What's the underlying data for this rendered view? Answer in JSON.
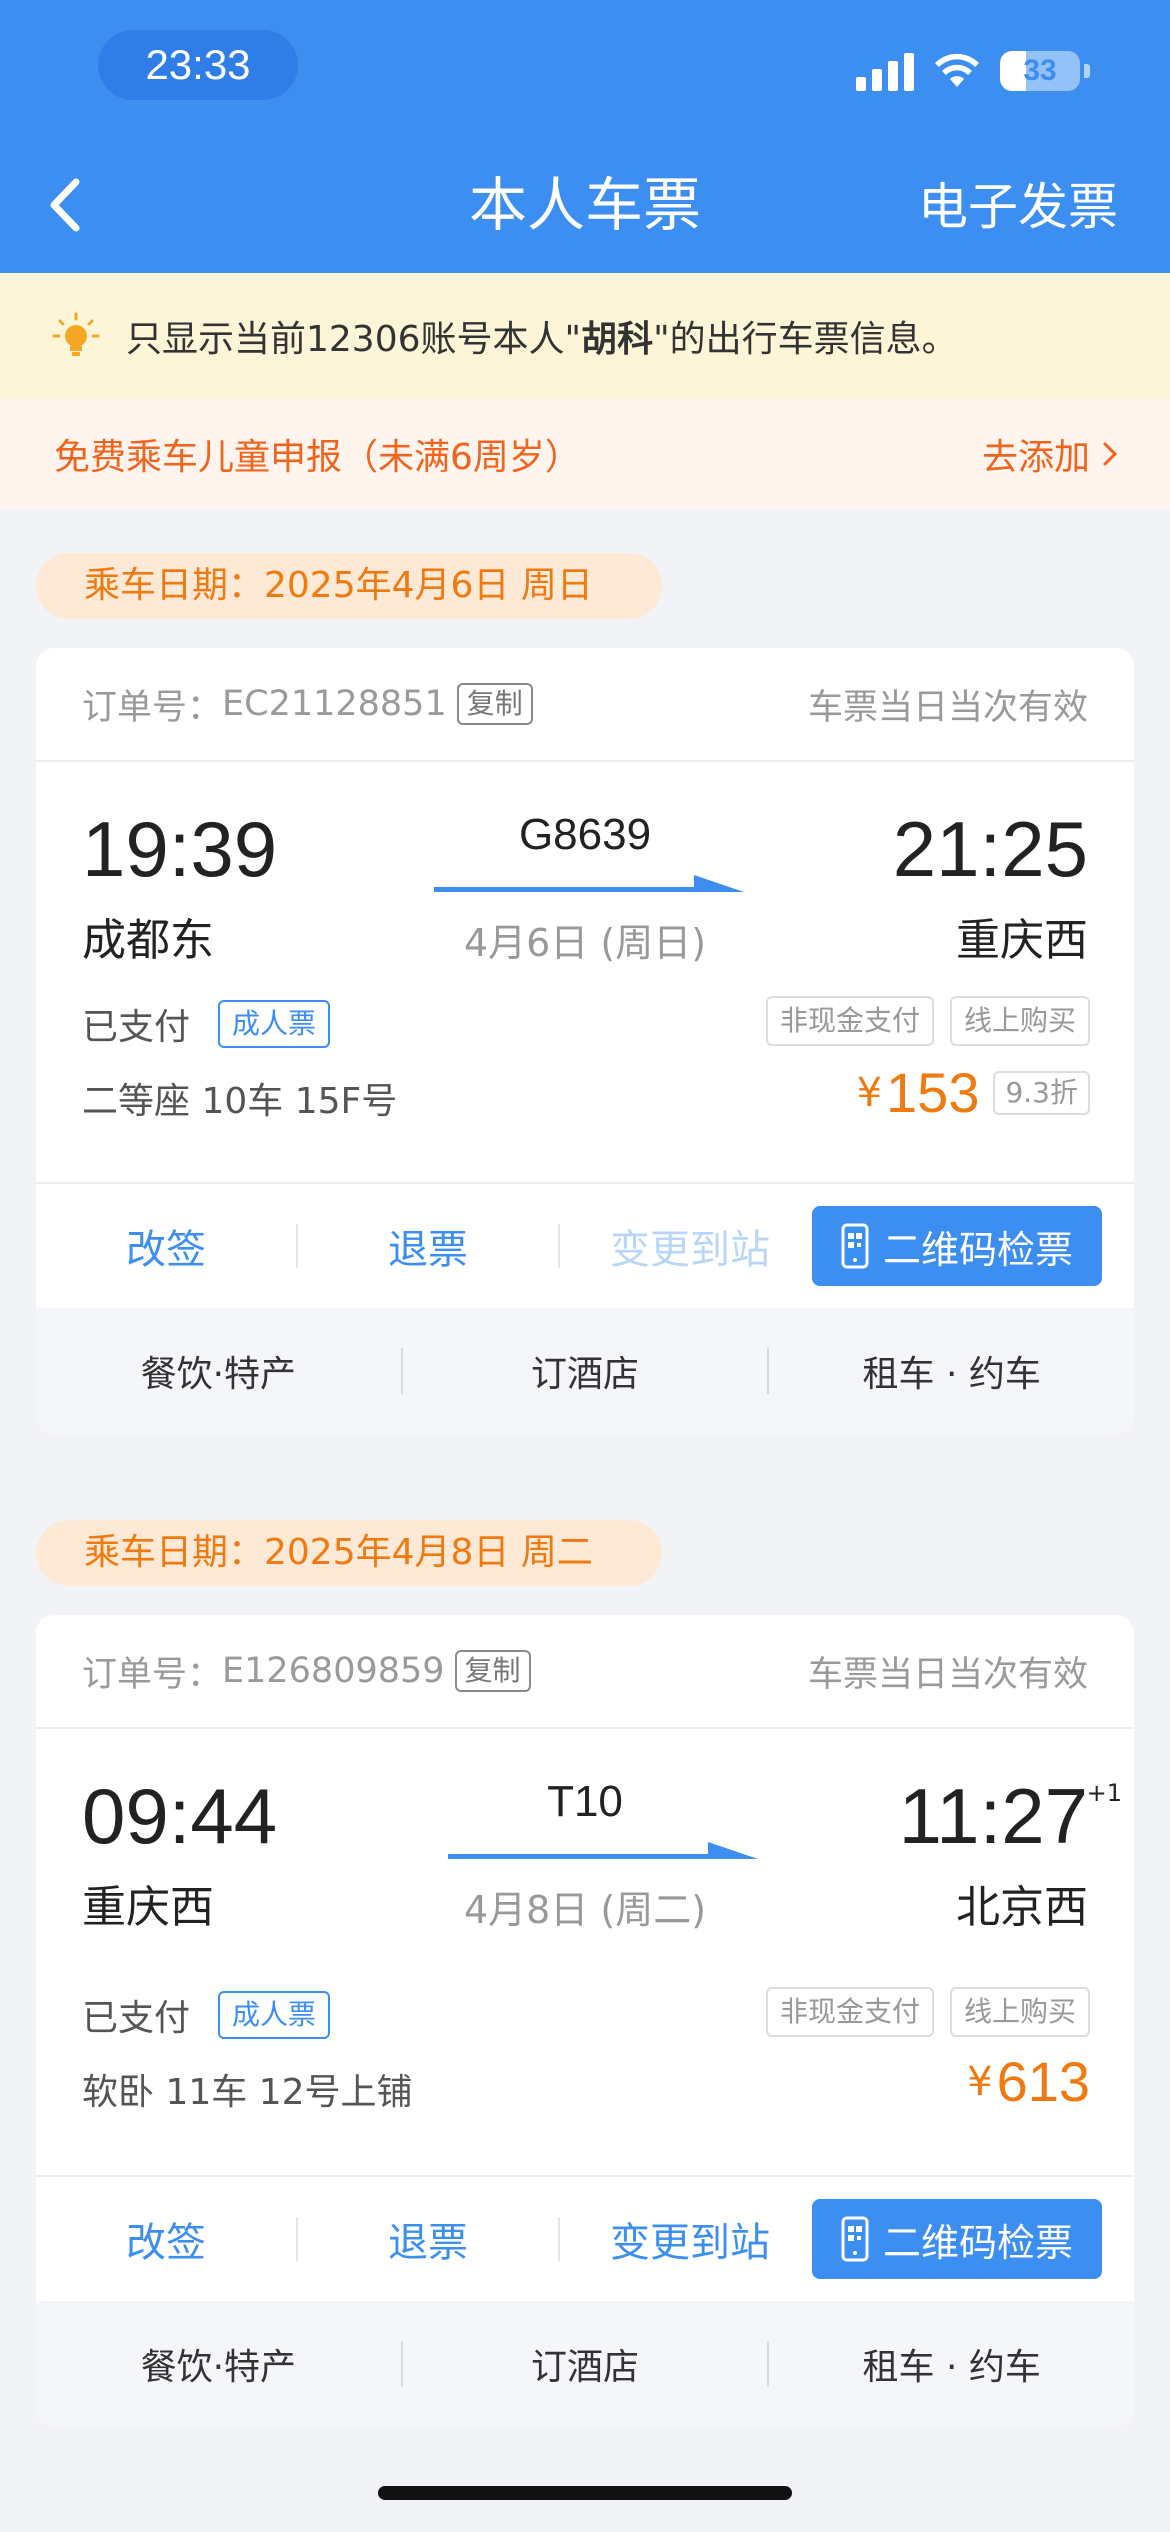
{
  "status_bar": {
    "time": "23:33",
    "battery": "33",
    "battery_level": 0.33
  },
  "nav": {
    "title": "本人车票",
    "right_link": "电子发票"
  },
  "notice": {
    "prefix": "只显示当前12306账号本人\"",
    "name": "胡科",
    "suffix": "\"的出行车票信息。"
  },
  "child_bar": {
    "label": "免费乘车儿童申报（未满6周岁）",
    "action": "去添加"
  },
  "tickets": [
    {
      "date_label": "乘车日期：2025年4月6日 周日",
      "order_label": "订单号：",
      "order_no": "EC21128851",
      "copy": "复制",
      "validity": "车票当日当次有效",
      "dep_time": "19:39",
      "dep_station": "成都东",
      "train": "G8639",
      "date_mid": "4月6日 (周日)",
      "arr_time": "21:25",
      "arr_sup": "",
      "arr_station": "重庆西",
      "paid": "已支付",
      "ticket_type": "成人票",
      "tags": [
        "非现金支付",
        "线上购买"
      ],
      "seat": "二等座 10车 15F号",
      "currency": "¥",
      "price": "153",
      "discount": "9.3折",
      "actions": {
        "change": "改签",
        "refund": "退票",
        "change_station": "变更到站",
        "change_station_enabled": false,
        "qr": "二维码检票"
      },
      "services": [
        "餐饮·特产",
        "订酒店",
        "租车 · 约车"
      ]
    },
    {
      "date_label": "乘车日期：2025年4月8日 周二",
      "order_label": "订单号：",
      "order_no": "E126809859",
      "copy": "复制",
      "validity": "车票当日当次有效",
      "dep_time": "09:44",
      "dep_station": "重庆西",
      "train": "T10",
      "date_mid": "4月8日 (周二)",
      "arr_time": "11:27",
      "arr_sup": "+1",
      "arr_station": "北京西",
      "paid": "已支付",
      "ticket_type": "成人票",
      "tags": [
        "非现金支付",
        "线上购买"
      ],
      "seat": "软卧 11车 12号上铺",
      "currency": "¥",
      "price": "613",
      "discount": "",
      "actions": {
        "change": "改签",
        "refund": "退票",
        "change_station": "变更到站",
        "change_station_enabled": true,
        "qr": "二维码检票"
      },
      "services": [
        "餐饮·特产",
        "订酒店",
        "租车 · 约车"
      ]
    }
  ]
}
